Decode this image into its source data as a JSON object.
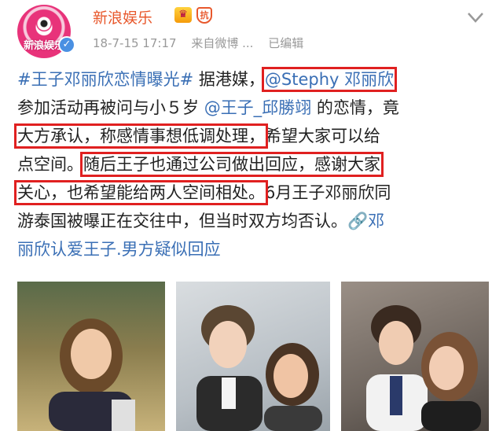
{
  "header": {
    "avatar_label": "新浪娱乐",
    "username": "新浪娱乐",
    "badge_shield": "抗",
    "timestamp": "18-7-15 17:17",
    "source": "来自微博 ...",
    "edited": "已编辑"
  },
  "post": {
    "line1": {
      "hashtag": "#王子邓丽欣恋情曝光#",
      "text": " 据港媒，",
      "mention": "@Stephy 邓丽欣"
    },
    "line2": {
      "text_a": "参加活动再被问与小５岁 ",
      "mention": "@王子_邱勝翊",
      "text_b": " 的恋情，竟"
    },
    "line3": {
      "boxed": "大方承认，称感情事想低调处理，",
      "text": "希望大家可以给"
    },
    "line4": {
      "text": "点空间。",
      "boxed": "随后王子也通过公司做出回应，感谢大家"
    },
    "line5": {
      "boxed": "关心，也希望能给两人空间相处。",
      "text": "6月王子邓丽欣同"
    },
    "line6": {
      "text": "游泰国被曝正在交往中，但当时双方均否认。",
      "link": "🔗邓"
    },
    "line7": {
      "link": "丽欣认爱王子.男方疑似回应"
    }
  },
  "photos": [
    "photo-1",
    "photo-2",
    "photo-3"
  ],
  "colors": {
    "username": "#e8582c",
    "link": "#3a6fb5",
    "highlight": "#e02020",
    "meta": "#999999"
  }
}
